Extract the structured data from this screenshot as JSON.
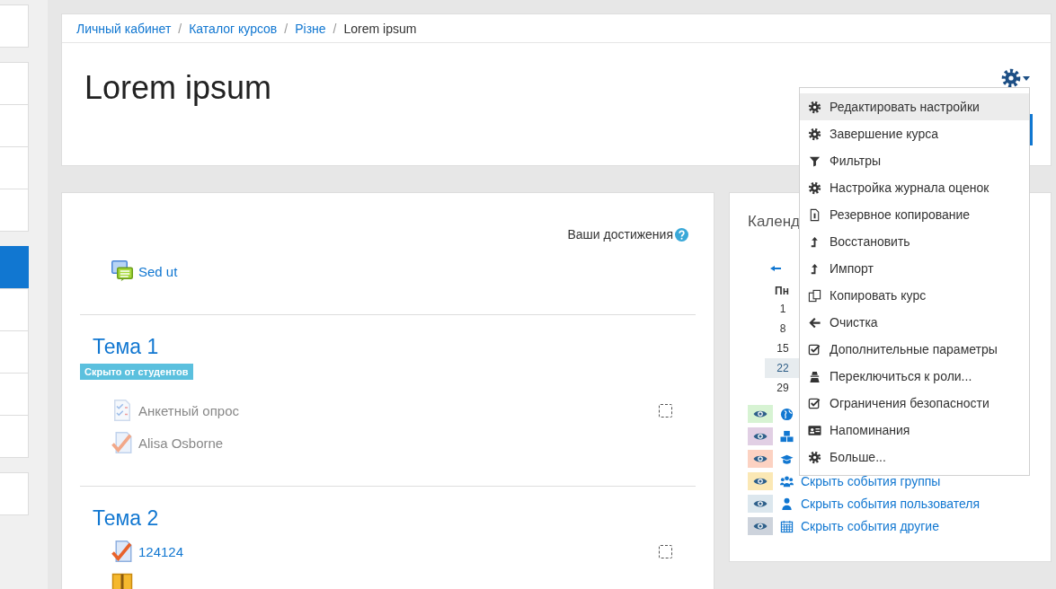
{
  "sidebar": {
    "groups": [
      [
        {
          "selected": false
        }
      ],
      [
        {
          "selected": false
        },
        {
          "selected": false
        },
        {
          "selected": false
        },
        {
          "selected": false
        }
      ],
      [
        {
          "selected": true
        },
        {
          "selected": false
        },
        {
          "selected": false
        },
        {
          "selected": false
        },
        {
          "selected": false
        }
      ],
      [
        {
          "selected": false
        }
      ]
    ]
  },
  "breadcrumb": [
    {
      "label": "Личный кабинет",
      "link": true
    },
    {
      "separator": "/",
      "label": "Каталог курсов",
      "link": true
    },
    {
      "separator": "/",
      "label": "Різне",
      "link": true
    },
    {
      "separator": "/",
      "label": "Lorem ipsum",
      "link": false
    }
  ],
  "page_title": "Lorem ipsum",
  "settings_menu": {
    "items": [
      {
        "kind": "gear",
        "label": "Редактировать настройки",
        "selected": true
      },
      {
        "kind": "gear",
        "label": "Завершение курса",
        "selected": false
      },
      {
        "kind": "filter",
        "label": "Фильтры",
        "selected": false
      },
      {
        "kind": "gear",
        "label": "Настройка журнала оценок",
        "selected": false
      },
      {
        "kind": "backup",
        "label": "Резервное копирование",
        "selected": false
      },
      {
        "kind": "upload",
        "label": "Восстановить",
        "selected": false
      },
      {
        "kind": "upload",
        "label": "Импорт",
        "selected": false
      },
      {
        "kind": "copy",
        "label": "Копировать курс",
        "selected": false
      },
      {
        "kind": "arrow-left",
        "label": "Очистка",
        "selected": false
      },
      {
        "kind": "checkbox",
        "label": "Дополнительные параметры",
        "selected": false
      },
      {
        "kind": "user-secret",
        "label": "Переключиться к роли...",
        "selected": false
      },
      {
        "kind": "checkbox",
        "label": "Ограничения безопасности",
        "selected": false
      },
      {
        "kind": "id-card",
        "label": "Напоминания",
        "selected": false
      },
      {
        "kind": "gear",
        "label": "Больше...",
        "selected": false
      }
    ]
  },
  "course": {
    "achievements": "Ваши достижения",
    "intro_activities": [
      {
        "kind": "forum",
        "label": "Sed ut",
        "dimmed": false
      }
    ],
    "sections": [
      {
        "title": "Тема 1",
        "badge": "Скрыто от студентов",
        "activities": [
          {
            "kind": "survey",
            "label": "Анкетный опрос",
            "dimmed": true,
            "completion": {
              "checked": false
            }
          },
          {
            "kind": "assign",
            "label": "Alisa Osborne",
            "dimmed": true
          }
        ]
      },
      {
        "title": "Тема 2",
        "activities": [
          {
            "kind": "assign",
            "label": "124124",
            "dimmed": false,
            "completion": {
              "checked": false
            }
          },
          {
            "kind": "package",
            "dimmed": false
          }
        ]
      }
    ]
  },
  "calendar": {
    "title": "Календ",
    "weekday": "Пн",
    "days": [
      {
        "label": "1",
        "today": false
      },
      {
        "label": "8",
        "today": false
      },
      {
        "label": "15",
        "today": false
      },
      {
        "label": "22",
        "today": true
      },
      {
        "label": "29",
        "today": false
      }
    ],
    "legend": [
      {
        "color": "#d7f3d3",
        "kind": "globe"
      },
      {
        "color": "#e1cfe4",
        "kind": "cubes"
      },
      {
        "color": "#fcd2c2",
        "kind": "graduation-cap"
      },
      {
        "color": "#fbe8b5",
        "kind": "users",
        "label": "Скрыть события группы"
      },
      {
        "color": "#dce7ee",
        "kind": "user",
        "label": "Скрыть события пользователя"
      },
      {
        "color": "#cdd3dc",
        "kind": "calendar",
        "label": "Скрыть события другие"
      }
    ]
  }
}
